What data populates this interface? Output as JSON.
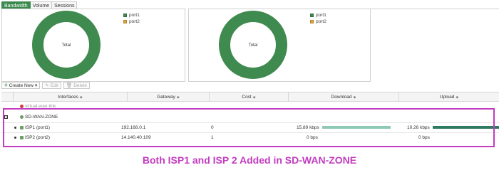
{
  "tabs": [
    {
      "label": "Bandwidth",
      "active": true
    },
    {
      "label": "Volume",
      "active": false
    },
    {
      "label": "Sessions",
      "active": false
    }
  ],
  "charts": [
    {
      "center_label": "Total",
      "legend": [
        {
          "label": "port1",
          "color": "#3f8a4f"
        },
        {
          "label": "port2",
          "color": "#e5a43a"
        }
      ]
    },
    {
      "center_label": "Total",
      "legend": [
        {
          "label": "port1",
          "color": "#3f8a4f"
        },
        {
          "label": "port2",
          "color": "#e5a43a"
        }
      ]
    }
  ],
  "chart_data": [
    {
      "type": "pie",
      "labels": [
        "port1",
        "port2"
      ],
      "values": [
        100,
        0
      ],
      "center_label": "Total"
    },
    {
      "type": "pie",
      "labels": [
        "port1",
        "port2"
      ],
      "values": [
        100,
        0
      ],
      "center_label": "Total"
    }
  ],
  "toolbar": {
    "create_new": "Create New",
    "edit": "Edit",
    "delete": "Delete"
  },
  "table": {
    "headers": {
      "interfaces": "Interfaces",
      "gateway": "Gateway",
      "cost": "Cost",
      "download": "Download",
      "upload": "Upload"
    },
    "rows": {
      "virtual_wan_link": {
        "name": "virtual-wan-link"
      },
      "zone": {
        "name": "SD-WAN-ZONE"
      },
      "isp1": {
        "name": "ISP1 (port1)",
        "gateway": "192.168.0.1",
        "cost": "0",
        "download": "15.89 kbps",
        "upload": "10.26 kbps",
        "download_fill": 0.8,
        "upload_fill": 1.0
      },
      "isp2": {
        "name": "ISP2 (port2)",
        "gateway": "14.140.40.109",
        "cost": "1",
        "download": "0 bps",
        "upload": "0 bps",
        "download_fill": 0,
        "upload_fill": 0
      }
    }
  },
  "caption": "Both ISP1 and ISP 2 Added in SD-WAN-ZONE",
  "colors": {
    "accent_green": "#3b8a4d",
    "highlight": "#c23bc0",
    "download_bar": "#8fc9b5",
    "upload_bar": "#2f7a63"
  }
}
